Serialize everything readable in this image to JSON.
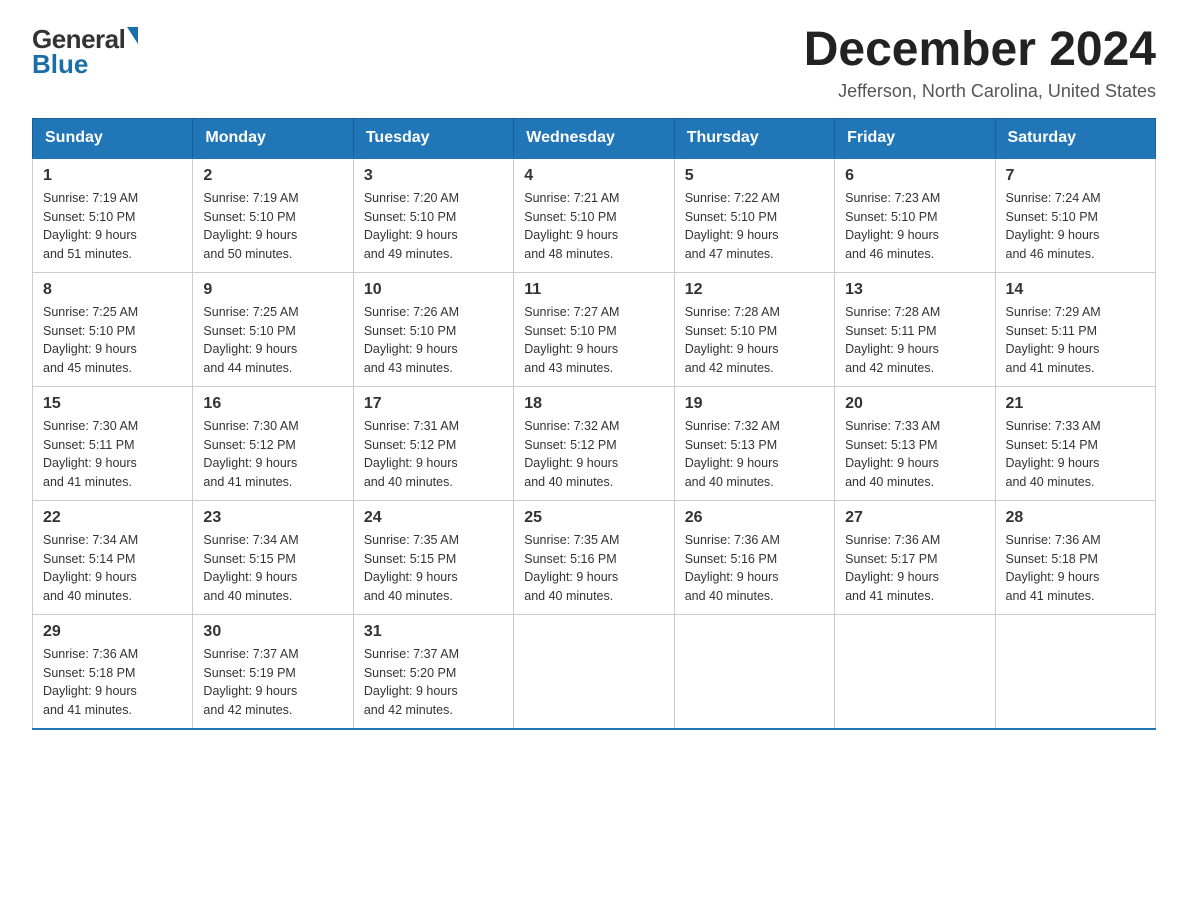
{
  "header": {
    "logo_general": "General",
    "logo_blue": "Blue",
    "month_title": "December 2024",
    "location": "Jefferson, North Carolina, United States"
  },
  "days_of_week": [
    "Sunday",
    "Monday",
    "Tuesday",
    "Wednesday",
    "Thursday",
    "Friday",
    "Saturday"
  ],
  "weeks": [
    [
      {
        "day": "1",
        "sunrise": "7:19 AM",
        "sunset": "5:10 PM",
        "daylight": "9 hours and 51 minutes."
      },
      {
        "day": "2",
        "sunrise": "7:19 AM",
        "sunset": "5:10 PM",
        "daylight": "9 hours and 50 minutes."
      },
      {
        "day": "3",
        "sunrise": "7:20 AM",
        "sunset": "5:10 PM",
        "daylight": "9 hours and 49 minutes."
      },
      {
        "day": "4",
        "sunrise": "7:21 AM",
        "sunset": "5:10 PM",
        "daylight": "9 hours and 48 minutes."
      },
      {
        "day": "5",
        "sunrise": "7:22 AM",
        "sunset": "5:10 PM",
        "daylight": "9 hours and 47 minutes."
      },
      {
        "day": "6",
        "sunrise": "7:23 AM",
        "sunset": "5:10 PM",
        "daylight": "9 hours and 46 minutes."
      },
      {
        "day": "7",
        "sunrise": "7:24 AM",
        "sunset": "5:10 PM",
        "daylight": "9 hours and 46 minutes."
      }
    ],
    [
      {
        "day": "8",
        "sunrise": "7:25 AM",
        "sunset": "5:10 PM",
        "daylight": "9 hours and 45 minutes."
      },
      {
        "day": "9",
        "sunrise": "7:25 AM",
        "sunset": "5:10 PM",
        "daylight": "9 hours and 44 minutes."
      },
      {
        "day": "10",
        "sunrise": "7:26 AM",
        "sunset": "5:10 PM",
        "daylight": "9 hours and 43 minutes."
      },
      {
        "day": "11",
        "sunrise": "7:27 AM",
        "sunset": "5:10 PM",
        "daylight": "9 hours and 43 minutes."
      },
      {
        "day": "12",
        "sunrise": "7:28 AM",
        "sunset": "5:10 PM",
        "daylight": "9 hours and 42 minutes."
      },
      {
        "day": "13",
        "sunrise": "7:28 AM",
        "sunset": "5:11 PM",
        "daylight": "9 hours and 42 minutes."
      },
      {
        "day": "14",
        "sunrise": "7:29 AM",
        "sunset": "5:11 PM",
        "daylight": "9 hours and 41 minutes."
      }
    ],
    [
      {
        "day": "15",
        "sunrise": "7:30 AM",
        "sunset": "5:11 PM",
        "daylight": "9 hours and 41 minutes."
      },
      {
        "day": "16",
        "sunrise": "7:30 AM",
        "sunset": "5:12 PM",
        "daylight": "9 hours and 41 minutes."
      },
      {
        "day": "17",
        "sunrise": "7:31 AM",
        "sunset": "5:12 PM",
        "daylight": "9 hours and 40 minutes."
      },
      {
        "day": "18",
        "sunrise": "7:32 AM",
        "sunset": "5:12 PM",
        "daylight": "9 hours and 40 minutes."
      },
      {
        "day": "19",
        "sunrise": "7:32 AM",
        "sunset": "5:13 PM",
        "daylight": "9 hours and 40 minutes."
      },
      {
        "day": "20",
        "sunrise": "7:33 AM",
        "sunset": "5:13 PM",
        "daylight": "9 hours and 40 minutes."
      },
      {
        "day": "21",
        "sunrise": "7:33 AM",
        "sunset": "5:14 PM",
        "daylight": "9 hours and 40 minutes."
      }
    ],
    [
      {
        "day": "22",
        "sunrise": "7:34 AM",
        "sunset": "5:14 PM",
        "daylight": "9 hours and 40 minutes."
      },
      {
        "day": "23",
        "sunrise": "7:34 AM",
        "sunset": "5:15 PM",
        "daylight": "9 hours and 40 minutes."
      },
      {
        "day": "24",
        "sunrise": "7:35 AM",
        "sunset": "5:15 PM",
        "daylight": "9 hours and 40 minutes."
      },
      {
        "day": "25",
        "sunrise": "7:35 AM",
        "sunset": "5:16 PM",
        "daylight": "9 hours and 40 minutes."
      },
      {
        "day": "26",
        "sunrise": "7:36 AM",
        "sunset": "5:16 PM",
        "daylight": "9 hours and 40 minutes."
      },
      {
        "day": "27",
        "sunrise": "7:36 AM",
        "sunset": "5:17 PM",
        "daylight": "9 hours and 41 minutes."
      },
      {
        "day": "28",
        "sunrise": "7:36 AM",
        "sunset": "5:18 PM",
        "daylight": "9 hours and 41 minutes."
      }
    ],
    [
      {
        "day": "29",
        "sunrise": "7:36 AM",
        "sunset": "5:18 PM",
        "daylight": "9 hours and 41 minutes."
      },
      {
        "day": "30",
        "sunrise": "7:37 AM",
        "sunset": "5:19 PM",
        "daylight": "9 hours and 42 minutes."
      },
      {
        "day": "31",
        "sunrise": "7:37 AM",
        "sunset": "5:20 PM",
        "daylight": "9 hours and 42 minutes."
      },
      null,
      null,
      null,
      null
    ]
  ],
  "labels": {
    "sunrise": "Sunrise:",
    "sunset": "Sunset:",
    "daylight": "Daylight:"
  }
}
